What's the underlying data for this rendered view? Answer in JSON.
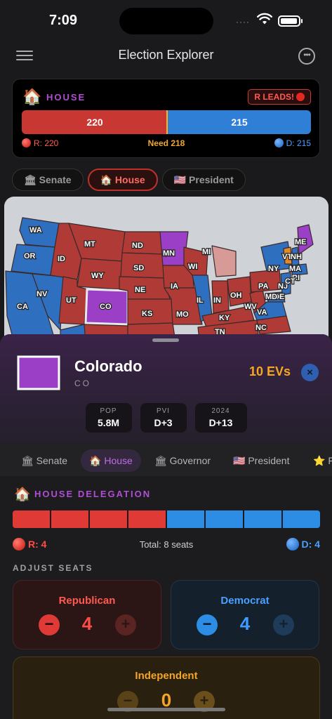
{
  "status_bar": {
    "time": "7:09",
    "signal": "····"
  },
  "nav": {
    "title": "Election Explorer"
  },
  "house_card": {
    "label": "HOUSE",
    "leads_badge": "R LEADS!",
    "r_seats": "220",
    "d_seats": "215",
    "r_total": 220,
    "d_total": 215,
    "r_label": "R: 220",
    "need_label": "Need 218",
    "d_label": "D: 215"
  },
  "top_tabs": [
    {
      "label": "Senate",
      "icon": "🏛"
    },
    {
      "label": "House",
      "icon": "🏠"
    },
    {
      "label": "President",
      "icon": "🇺🇸"
    }
  ],
  "map_states": [
    "WA",
    "OR",
    "CA",
    "NV",
    "ID",
    "MT",
    "WY",
    "UT",
    "CO",
    "ND",
    "SD",
    "NE",
    "KS",
    "MN",
    "IA",
    "MO",
    "WI",
    "MI",
    "IL",
    "IN",
    "OH",
    "KY",
    "TN",
    "WV",
    "VA",
    "NC",
    "PA",
    "NY",
    "VT",
    "NH",
    "ME",
    "MA",
    "NJ",
    "DE",
    "MD",
    "RI",
    "CT"
  ],
  "colors": {
    "rep": "#c93732",
    "dem": "#2f7fd6",
    "swing": "#9b3fc7",
    "accent": "#b24dd6",
    "need": "#f0a92a"
  },
  "sheet": {
    "state_name": "Colorado",
    "state_abbr": "CO",
    "evs": "10 EVs",
    "close_icon": "×",
    "stats": [
      {
        "key": "POP",
        "value": "5.8M"
      },
      {
        "key": "PVI",
        "value": "D+3"
      },
      {
        "key": "2024",
        "value": "D+13"
      }
    ]
  },
  "lower_tabs": [
    {
      "label": "Senate",
      "icon": "🏛"
    },
    {
      "label": "House",
      "icon": "🏠"
    },
    {
      "label": "Governor",
      "icon": "🏛"
    },
    {
      "label": "President",
      "icon": "🇺🇸"
    },
    {
      "label": "F",
      "icon": "⭐"
    }
  ],
  "delegation": {
    "title": "HOUSE DELEGATION",
    "seats": [
      "R",
      "R",
      "R",
      "R",
      "D",
      "D",
      "D",
      "D"
    ],
    "r_label": "R: 4",
    "total_label": "Total: 8 seats",
    "d_label": "D: 4"
  },
  "adjust": {
    "title": "ADJUST SEATS",
    "republican": {
      "label": "Republican",
      "count": "4",
      "minus": "−",
      "plus": "+"
    },
    "democrat": {
      "label": "Democrat",
      "count": "4",
      "minus": "−",
      "plus": "+"
    },
    "independent": {
      "label": "Independent",
      "count": "0",
      "minus": "−",
      "plus": "+"
    }
  }
}
